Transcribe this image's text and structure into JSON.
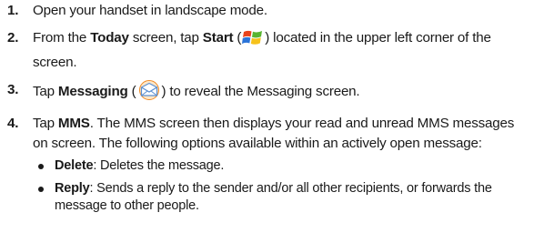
{
  "steps": [
    {
      "number": "1.",
      "text": "Open your handset in landscape mode."
    },
    {
      "number": "2.",
      "pre": "From the ",
      "bold1": "Today",
      "mid": " screen, tap ",
      "bold2": "Start",
      "icon_open": " (",
      "icon": "windows-flag-icon",
      "icon_close": ")",
      "post": " located in the upper left corner of the screen."
    },
    {
      "number": "3.",
      "pre": "Tap ",
      "bold": "Messaging",
      "icon_open": " (",
      "icon": "messaging-envelope-icon",
      "icon_close": ")",
      "post": " to reveal the Messaging screen."
    },
    {
      "number": "4.",
      "pre": "Tap ",
      "bold": "MMS",
      "post": ". The MMS screen then displays your read and unread MMS messages on screen. The following options available within an actively open message:",
      "options": [
        {
          "label": "Delete",
          "text": ": Deletes the message."
        },
        {
          "label": "Reply",
          "text": ": Sends a reply to the sender and/or all other recipients, or forwards the message to other people."
        }
      ]
    }
  ],
  "colors": {
    "text": "#1a1a1a",
    "flag_red": "#e8431c",
    "flag_green": "#59b531",
    "flag_blue": "#2b74d9",
    "flag_yellow": "#f6c21b",
    "envelope_orange": "#f08a24",
    "envelope_blue": "#5b8fd0"
  }
}
